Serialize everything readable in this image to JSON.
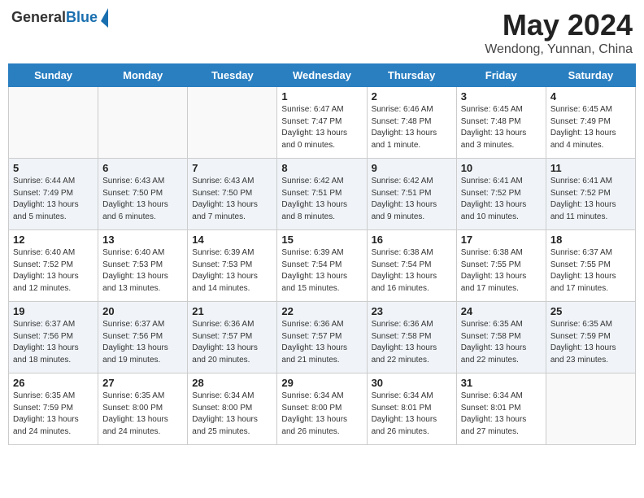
{
  "header": {
    "logo_general": "General",
    "logo_blue": "Blue",
    "title": "May 2024",
    "location": "Wendong, Yunnan, China"
  },
  "days_of_week": [
    "Sunday",
    "Monday",
    "Tuesday",
    "Wednesday",
    "Thursday",
    "Friday",
    "Saturday"
  ],
  "weeks": [
    [
      {
        "day": "",
        "info": ""
      },
      {
        "day": "",
        "info": ""
      },
      {
        "day": "",
        "info": ""
      },
      {
        "day": "1",
        "info": "Sunrise: 6:47 AM\nSunset: 7:47 PM\nDaylight: 13 hours\nand 0 minutes."
      },
      {
        "day": "2",
        "info": "Sunrise: 6:46 AM\nSunset: 7:48 PM\nDaylight: 13 hours\nand 1 minute."
      },
      {
        "day": "3",
        "info": "Sunrise: 6:45 AM\nSunset: 7:48 PM\nDaylight: 13 hours\nand 3 minutes."
      },
      {
        "day": "4",
        "info": "Sunrise: 6:45 AM\nSunset: 7:49 PM\nDaylight: 13 hours\nand 4 minutes."
      }
    ],
    [
      {
        "day": "5",
        "info": "Sunrise: 6:44 AM\nSunset: 7:49 PM\nDaylight: 13 hours\nand 5 minutes."
      },
      {
        "day": "6",
        "info": "Sunrise: 6:43 AM\nSunset: 7:50 PM\nDaylight: 13 hours\nand 6 minutes."
      },
      {
        "day": "7",
        "info": "Sunrise: 6:43 AM\nSunset: 7:50 PM\nDaylight: 13 hours\nand 7 minutes."
      },
      {
        "day": "8",
        "info": "Sunrise: 6:42 AM\nSunset: 7:51 PM\nDaylight: 13 hours\nand 8 minutes."
      },
      {
        "day": "9",
        "info": "Sunrise: 6:42 AM\nSunset: 7:51 PM\nDaylight: 13 hours\nand 9 minutes."
      },
      {
        "day": "10",
        "info": "Sunrise: 6:41 AM\nSunset: 7:52 PM\nDaylight: 13 hours\nand 10 minutes."
      },
      {
        "day": "11",
        "info": "Sunrise: 6:41 AM\nSunset: 7:52 PM\nDaylight: 13 hours\nand 11 minutes."
      }
    ],
    [
      {
        "day": "12",
        "info": "Sunrise: 6:40 AM\nSunset: 7:52 PM\nDaylight: 13 hours\nand 12 minutes."
      },
      {
        "day": "13",
        "info": "Sunrise: 6:40 AM\nSunset: 7:53 PM\nDaylight: 13 hours\nand 13 minutes."
      },
      {
        "day": "14",
        "info": "Sunrise: 6:39 AM\nSunset: 7:53 PM\nDaylight: 13 hours\nand 14 minutes."
      },
      {
        "day": "15",
        "info": "Sunrise: 6:39 AM\nSunset: 7:54 PM\nDaylight: 13 hours\nand 15 minutes."
      },
      {
        "day": "16",
        "info": "Sunrise: 6:38 AM\nSunset: 7:54 PM\nDaylight: 13 hours\nand 16 minutes."
      },
      {
        "day": "17",
        "info": "Sunrise: 6:38 AM\nSunset: 7:55 PM\nDaylight: 13 hours\nand 17 minutes."
      },
      {
        "day": "18",
        "info": "Sunrise: 6:37 AM\nSunset: 7:55 PM\nDaylight: 13 hours\nand 17 minutes."
      }
    ],
    [
      {
        "day": "19",
        "info": "Sunrise: 6:37 AM\nSunset: 7:56 PM\nDaylight: 13 hours\nand 18 minutes."
      },
      {
        "day": "20",
        "info": "Sunrise: 6:37 AM\nSunset: 7:56 PM\nDaylight: 13 hours\nand 19 minutes."
      },
      {
        "day": "21",
        "info": "Sunrise: 6:36 AM\nSunset: 7:57 PM\nDaylight: 13 hours\nand 20 minutes."
      },
      {
        "day": "22",
        "info": "Sunrise: 6:36 AM\nSunset: 7:57 PM\nDaylight: 13 hours\nand 21 minutes."
      },
      {
        "day": "23",
        "info": "Sunrise: 6:36 AM\nSunset: 7:58 PM\nDaylight: 13 hours\nand 22 minutes."
      },
      {
        "day": "24",
        "info": "Sunrise: 6:35 AM\nSunset: 7:58 PM\nDaylight: 13 hours\nand 22 minutes."
      },
      {
        "day": "25",
        "info": "Sunrise: 6:35 AM\nSunset: 7:59 PM\nDaylight: 13 hours\nand 23 minutes."
      }
    ],
    [
      {
        "day": "26",
        "info": "Sunrise: 6:35 AM\nSunset: 7:59 PM\nDaylight: 13 hours\nand 24 minutes."
      },
      {
        "day": "27",
        "info": "Sunrise: 6:35 AM\nSunset: 8:00 PM\nDaylight: 13 hours\nand 24 minutes."
      },
      {
        "day": "28",
        "info": "Sunrise: 6:34 AM\nSunset: 8:00 PM\nDaylight: 13 hours\nand 25 minutes."
      },
      {
        "day": "29",
        "info": "Sunrise: 6:34 AM\nSunset: 8:00 PM\nDaylight: 13 hours\nand 26 minutes."
      },
      {
        "day": "30",
        "info": "Sunrise: 6:34 AM\nSunset: 8:01 PM\nDaylight: 13 hours\nand 26 minutes."
      },
      {
        "day": "31",
        "info": "Sunrise: 6:34 AM\nSunset: 8:01 PM\nDaylight: 13 hours\nand 27 minutes."
      },
      {
        "day": "",
        "info": ""
      }
    ]
  ]
}
